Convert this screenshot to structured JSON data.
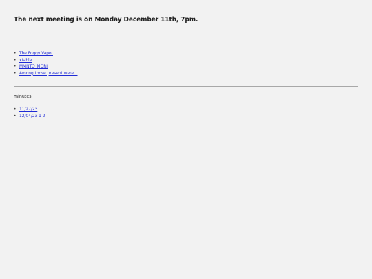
{
  "announcement": {
    "text": "The next meeting is on Monday December 11th, 7pm."
  },
  "links": [
    {
      "label": "The Foggy Vapor"
    },
    {
      "label": "xtable"
    },
    {
      "label": "MMNTO_MORI"
    },
    {
      "label": "Among those present were..."
    }
  ],
  "minutes": {
    "label": "minutes",
    "entries": [
      {
        "label": "11/27/23"
      },
      {
        "label": "12/04/23 1",
        "extra": "2"
      }
    ]
  },
  "colors": {
    "background": "#f2f2f2",
    "link": "#1f2bd6",
    "rule": "#a8a8a8"
  }
}
